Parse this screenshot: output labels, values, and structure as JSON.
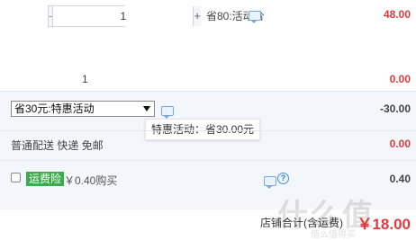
{
  "item": {
    "stepper": {
      "minus": "-",
      "value": "1",
      "plus": "+"
    },
    "promo_label": "省80:活动价",
    "price": "48.00",
    "quantity": "1",
    "subtotal": "0.00"
  },
  "discount": {
    "select_value": "省30元:特惠活动",
    "amount": "-30.00",
    "tooltip": "特惠活动：省30.00元"
  },
  "shipping": {
    "label": "普通配送 快递 免邮",
    "amount": "0.00"
  },
  "insurance": {
    "badge": "运费险",
    "price_text": "￥0.40购买",
    "amount": "0.40",
    "help": "?"
  },
  "total": {
    "label": "店铺合计(含运费)",
    "value": "￥18.00"
  },
  "watermark": {
    "main": "什么值",
    "sub": "值么值得买"
  },
  "colors": {
    "price_red": "#e4393c",
    "badge_green": "#3cab4b",
    "band_bg": "#f3f7fb"
  }
}
